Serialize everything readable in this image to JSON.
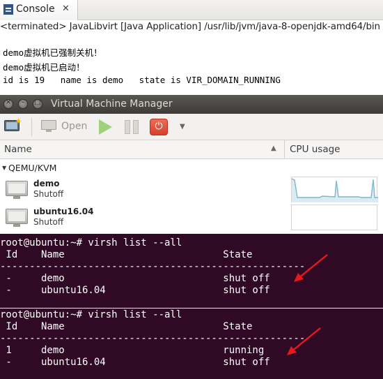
{
  "console": {
    "tab_label": "Console",
    "close_glyph": "✕",
    "icon": "console-icon",
    "terminated_line": "<terminated> JavaLibvirt [Java Application] /usr/lib/jvm/java-8-openjdk-amd64/bin",
    "output": [
      "demo虚拟机已强制关机！",
      "demo虚拟机已启动！",
      "id is 19   name is demo   state is VIR_DOMAIN_RUNNING"
    ]
  },
  "vmm": {
    "window_title": "Virtual Machine Manager",
    "window_buttons": [
      "×",
      "–",
      "□"
    ],
    "toolbar": {
      "new_icon": "new-vm-icon",
      "open_label": "Open",
      "run_icon": "play-icon",
      "pause_icon": "pause-icon",
      "shutdown_icon": "power-icon",
      "menu_icon": "dropdown-arrow-icon"
    },
    "columns": {
      "name": "Name",
      "cpu": "CPU usage"
    },
    "group": "QEMU/KVM",
    "vms": [
      {
        "name": "demo",
        "status": "Shutoff"
      },
      {
        "name": "ubuntu16.04",
        "status": "Shutoff"
      }
    ],
    "colors": {
      "graph_line": "#7fb7cc",
      "graph_fill": "#d9ecf3",
      "titlebar": "#3d3b37"
    }
  },
  "terminals": [
    {
      "prompt": "root@ubuntu:~# virsh list --all",
      "header": " Id    Name                           State",
      "rule": "----------------------------------------------------",
      "rows": [
        " -     demo                           shut off",
        " -     ubuntu16.04                    shut off"
      ]
    },
    {
      "prompt": "root@ubuntu:~# virsh list --all",
      "header": " Id    Name                           State",
      "rule": "----------------------------------------------------",
      "rows": [
        " 1     demo                           running",
        " -     ubuntu16.04                    shut off"
      ]
    }
  ],
  "colors": {
    "terminal_bg": "#300a24",
    "annotation_arrow": "#e8191c"
  }
}
